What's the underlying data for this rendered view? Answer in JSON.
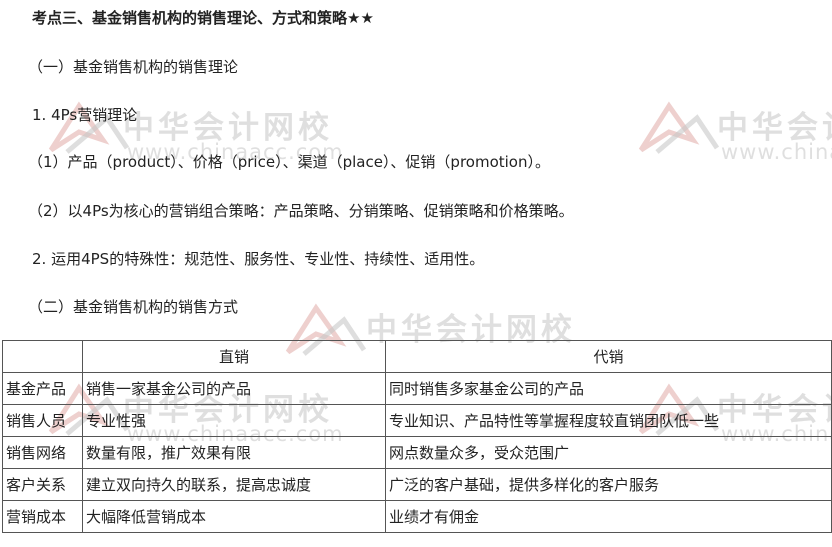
{
  "title": "考点三、基金销售机构的销售理论、方式和策略★★",
  "paragraphs": {
    "p1": "（一）基金销售机构的销售理论",
    "p2": "1. 4Ps营销理论",
    "p3": "（1）产品（product）、价格（price）、渠道（place）、促销（promotion）。",
    "p4": "（2）以4Ps为核心的营销组合策略：产品策略、分销策略、促销策略和价格策略。",
    "p5": "2. 运用4PS的特殊性：规范性、服务性、专业性、持续性、适用性。",
    "p6": "（二）基金销售机构的销售方式"
  },
  "table": {
    "headers": [
      "",
      "直销",
      "代销"
    ],
    "rows": [
      [
        "基金产品",
        "销售一家基金公司的产品",
        "同时销售多家基金公司的产品"
      ],
      [
        "销售人员",
        "专业性强",
        "专业知识、产品特性等掌握程度较直销团队低一些"
      ],
      [
        "销售网络",
        "数量有限，推广效果有限",
        "网点数量众多，受众范围广"
      ],
      [
        "客户关系",
        "建立双向持久的联系，提高忠诚度",
        "广泛的客户基础，提供多样化的客户服务"
      ],
      [
        "营销成本",
        "大幅降低营销成本",
        "业绩才有佣金"
      ]
    ]
  },
  "watermark": {
    "name": "中华会计网校",
    "url": "www.chinaacc.com",
    "color": "#b9b9b9"
  }
}
